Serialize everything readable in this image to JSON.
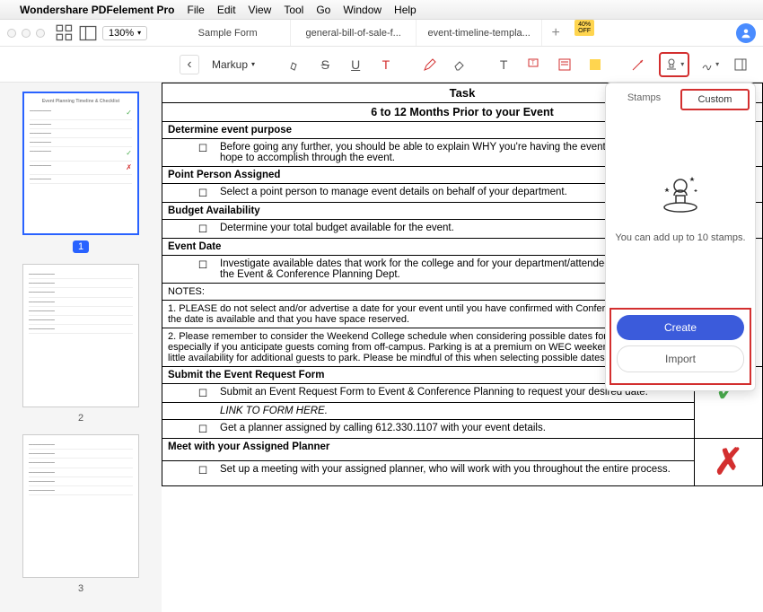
{
  "menubar": {
    "app": "Wondershare PDFelement Pro",
    "items": [
      "File",
      "Edit",
      "View",
      "Tool",
      "Go",
      "Window",
      "Help"
    ]
  },
  "titlebar": {
    "zoom": "130%",
    "tabs": [
      "Sample Form",
      "general-bill-of-sale-f...",
      "event-timeline-templa..."
    ]
  },
  "toolbar": {
    "markup": "Markup"
  },
  "thumbs": {
    "page1": "1",
    "page2": "2",
    "page3": "3"
  },
  "doc": {
    "task": "Task",
    "months": "6 to 12 Months Prior to your Event",
    "s1": "Determine event purpose",
    "s1_i1": "Before going any further, you should be able to explain WHY you're having the event and what you hope to accomplish through the event.",
    "s2": "Point Person Assigned",
    "s2_i1": "Select a point person to manage event details on behalf of your department.",
    "s3": "Budget Availability",
    "s3_i1": "Determine your total budget available for the event.",
    "s4": "Event Date",
    "s4_i1": "Investigate available dates that work for the college and for your department/attendees by contacting the Event & Conference Planning Dept.",
    "notes_h": "NOTES:",
    "notes_1": "1.  PLEASE do not select and/or advertise a date for your event until you have confirmed with Conference Planning that the date is available and that you have space reserved.",
    "notes_2": "2.  Please remember to consider the Weekend College schedule when considering possible dates for your event, especially if you anticipate guests coming from off-campus.  Parking is at a premium on WEC weekends, and we have little availability for additional guests to park.  Please be mindful of this when selecting possible dates.",
    "s5": "Submit the Event Request Form",
    "s5_i1": "Submit an Event Request Form to Event & Conference Planning to request your desired date.",
    "s5_link": "LINK TO FORM HERE.",
    "s5_i2": "Get a planner assigned by calling 612.330.1107 with your event details.",
    "s6": "Meet with your Assigned Planner",
    "s6_i1": "Set up a meeting with your assigned planner, who will work with you throughout the entire process."
  },
  "stamp": {
    "tab1": "Stamps",
    "tab2": "Custom",
    "msg": "You can add up to 10 stamps.",
    "create": "Create",
    "import": "Import"
  }
}
